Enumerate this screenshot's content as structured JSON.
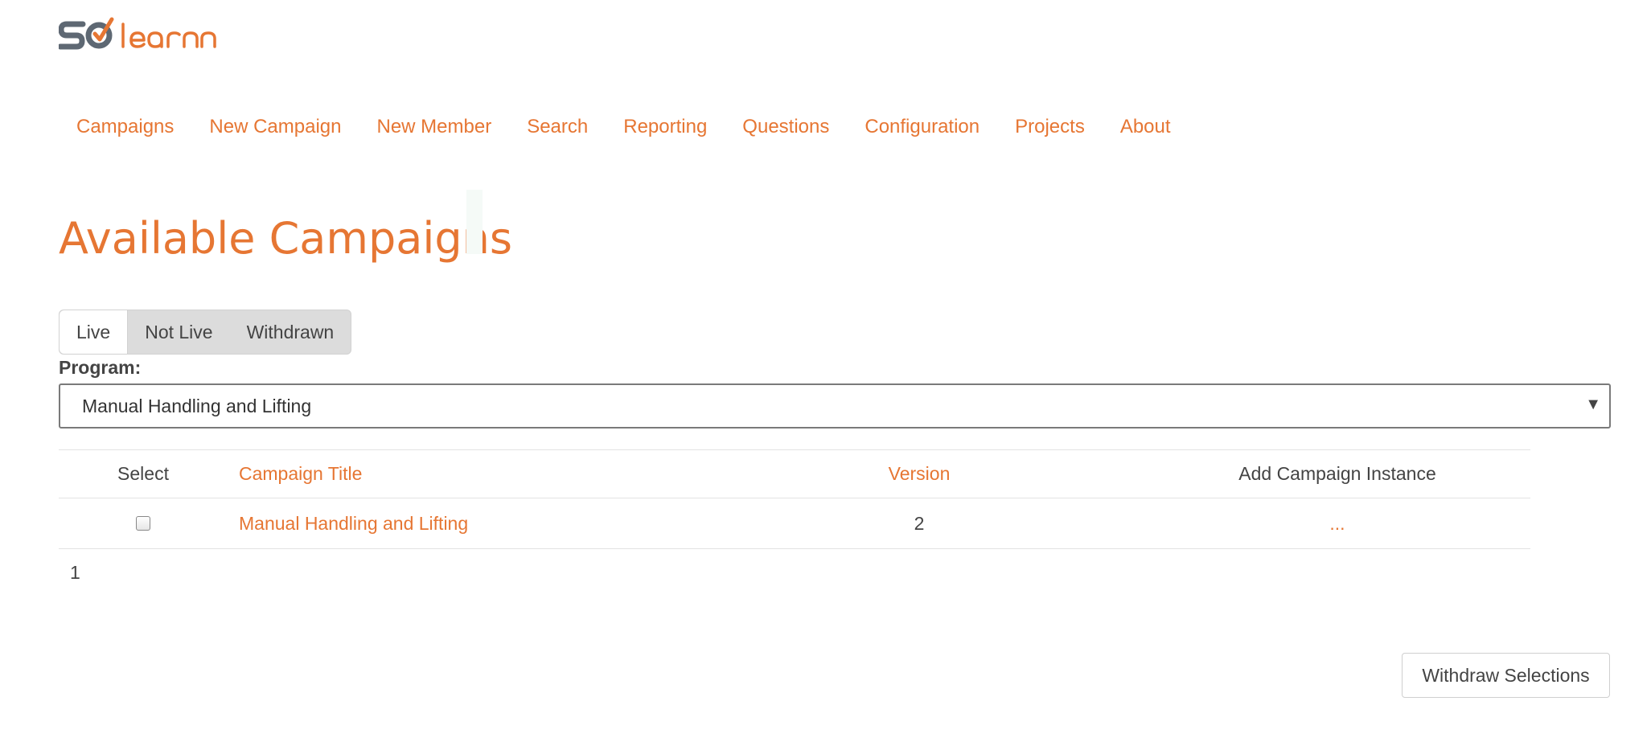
{
  "brand": {
    "logo_text": "SOlearn",
    "logo_primary": "#5e6873",
    "logo_accent": "#e67633"
  },
  "nav": {
    "items": [
      {
        "label": "Campaigns"
      },
      {
        "label": "New Campaign"
      },
      {
        "label": "New Member"
      },
      {
        "label": "Search"
      },
      {
        "label": "Reporting"
      },
      {
        "label": "Questions"
      },
      {
        "label": "Configuration"
      },
      {
        "label": "Projects"
      },
      {
        "label": "About"
      }
    ]
  },
  "page": {
    "title": "Available Campaigns"
  },
  "filter_tabs": {
    "items": [
      {
        "label": "Live",
        "active": true
      },
      {
        "label": "Not Live",
        "active": false
      },
      {
        "label": "Withdrawn",
        "active": false
      }
    ]
  },
  "program": {
    "label": "Program:",
    "selected": "Manual Handling and Lifting",
    "arrow": "▼"
  },
  "table": {
    "headers": {
      "select": "Select",
      "title": "Campaign Title",
      "version": "Version",
      "add_instance": "Add Campaign Instance"
    },
    "rows": [
      {
        "checked": false,
        "title": "Manual Handling and Lifting",
        "version": "2",
        "add_instance": "..."
      }
    ]
  },
  "pagination": {
    "current": "1"
  },
  "actions": {
    "withdraw_label": "Withdraw Selections"
  },
  "colors": {
    "accent": "#e67633",
    "text": "#444444",
    "tab_bg": "#dcdcdc"
  }
}
